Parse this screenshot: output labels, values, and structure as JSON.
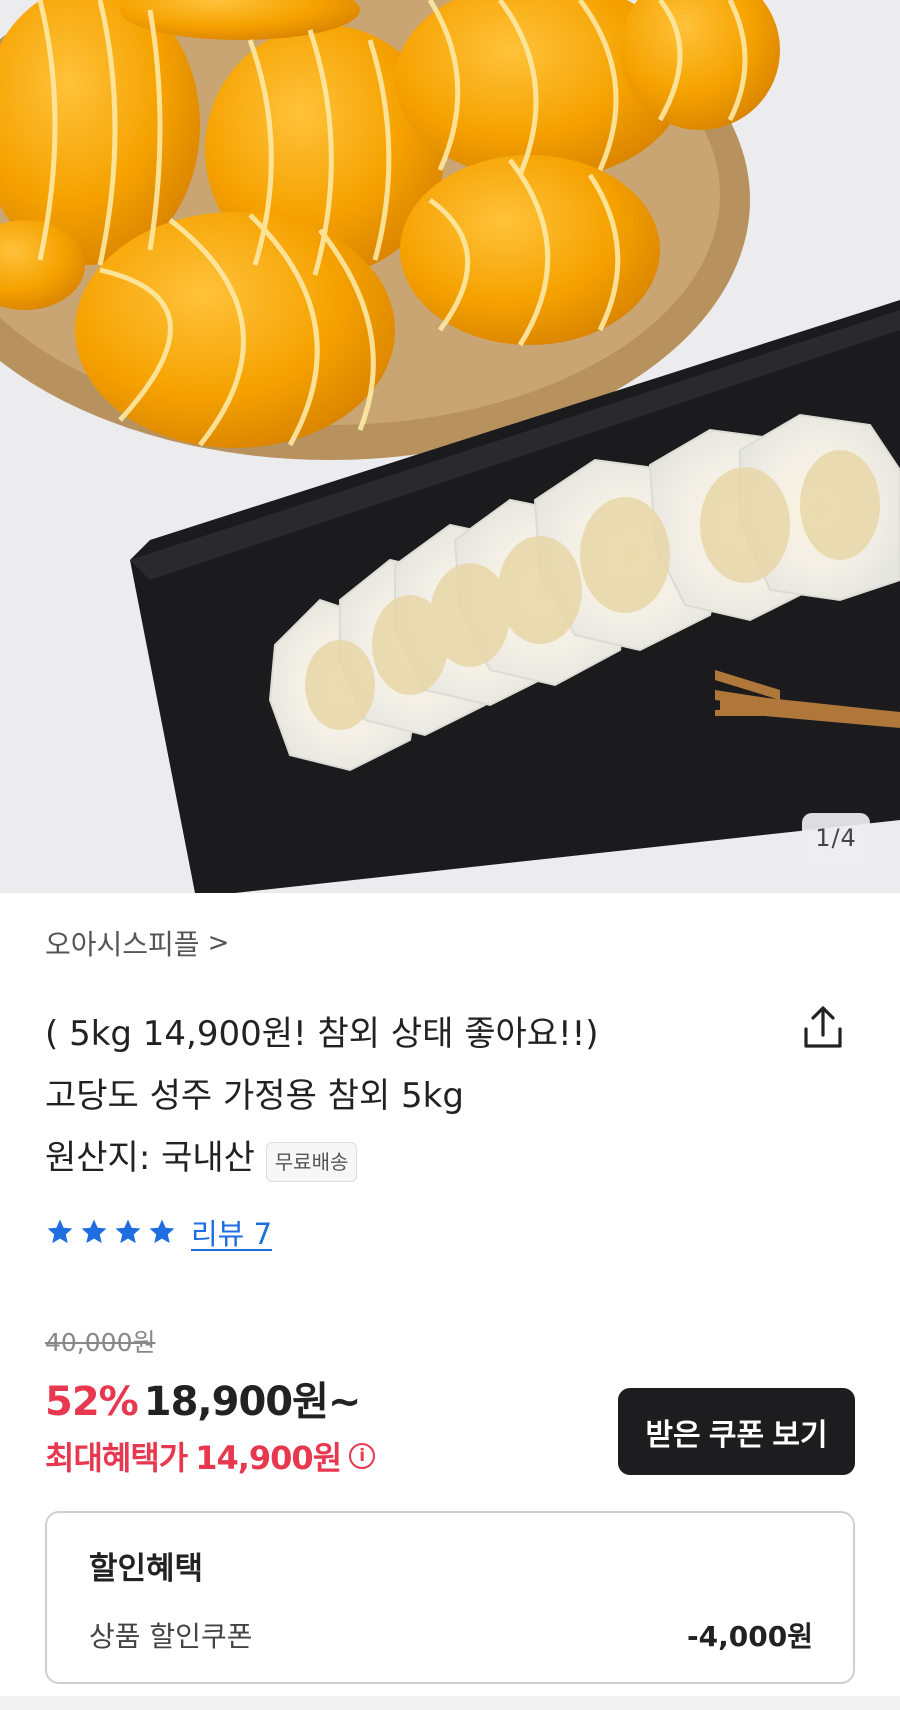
{
  "gallery": {
    "counter": "1/4"
  },
  "seller": {
    "name": "오아시스피플",
    "chevron": ">"
  },
  "product": {
    "title_line1": "( 5kg 14,900원! 참외 상태 좋아요!!)",
    "title_line2": "고당도 성주 가정용 참외 5kg",
    "origin": "원산지: 국내산",
    "shipping_badge": "무료배송"
  },
  "rating": {
    "stars": 4,
    "star_color": "#1e6ee0",
    "review_link": "리뷰 7"
  },
  "pricing": {
    "original_price": "40,000원",
    "discount": "52%",
    "price": "18,900원~",
    "max_benefit_label": "최대혜택가",
    "max_benefit_price": "14,900원",
    "accent_color": "#e8384f"
  },
  "coupon_button": {
    "label": "받은 쿠폰 보기"
  },
  "benefits": {
    "title": "할인혜택",
    "rows": [
      {
        "label": "상품 할인쿠폰",
        "value": "-4,000원"
      }
    ]
  }
}
